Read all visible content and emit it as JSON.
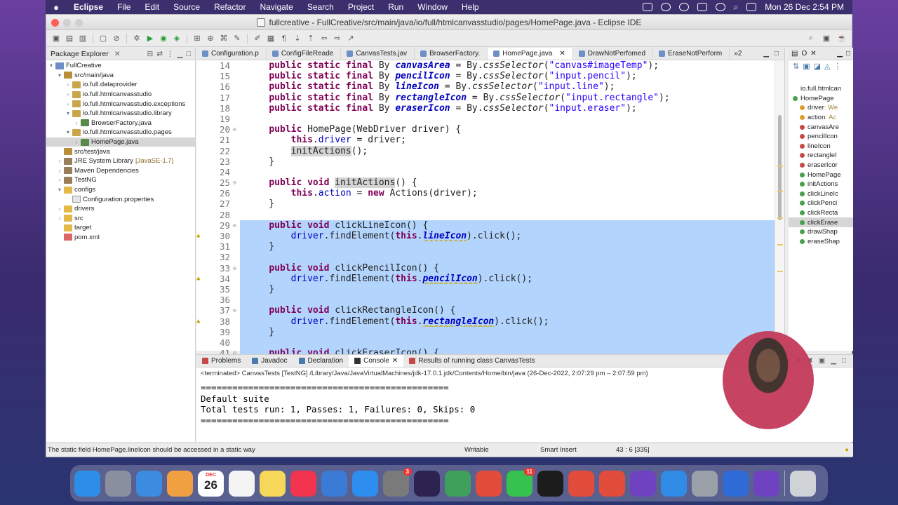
{
  "menubar": {
    "app": "Eclipse",
    "items": [
      "File",
      "Edit",
      "Source",
      "Refactor",
      "Navigate",
      "Search",
      "Project",
      "Run",
      "Window",
      "Help"
    ],
    "clock": "Mon 26 Dec  2:54 PM"
  },
  "window": {
    "title": "fullcreative - FullCreative/src/main/java/io/full/htmlcanvasstudio/pages/HomePage.java - Eclipse IDE"
  },
  "package_explorer": {
    "tab": "Package Explorer",
    "items": [
      {
        "label": "FullCreative",
        "indent": 0,
        "arrow": "▾",
        "icon": "proj"
      },
      {
        "label": "src/main/java",
        "indent": 1,
        "arrow": "▾",
        "icon": "src"
      },
      {
        "label": "io.full.dataprovider",
        "indent": 2,
        "arrow": "›",
        "icon": "pkg"
      },
      {
        "label": "io.full.htmlcanvasstudio",
        "indent": 2,
        "arrow": "›",
        "icon": "pkg"
      },
      {
        "label": "io.full.htmlcanvasstudio.exceptions",
        "indent": 2,
        "arrow": "›",
        "icon": "pkg"
      },
      {
        "label": "io.full.htmlcanvasstudio.library",
        "indent": 2,
        "arrow": "▾",
        "icon": "pkg"
      },
      {
        "label": "BrowserFactory.java",
        "indent": 3,
        "arrow": "›",
        "icon": "java"
      },
      {
        "label": "io.full.htmlcanvasstudio.pages",
        "indent": 2,
        "arrow": "▾",
        "icon": "pkg"
      },
      {
        "label": "HomePage.java",
        "indent": 3,
        "arrow": "›",
        "icon": "java",
        "selected": true
      },
      {
        "label": "src/test/java",
        "indent": 1,
        "arrow": "",
        "icon": "src"
      },
      {
        "label": "JRE System Library",
        "suffix": "[JavaSE-1.7]",
        "indent": 1,
        "arrow": "›",
        "icon": "lib"
      },
      {
        "label": "Maven Dependencies",
        "indent": 1,
        "arrow": "›",
        "icon": "lib"
      },
      {
        "label": "TestNG",
        "indent": 1,
        "arrow": "›",
        "icon": "lib"
      },
      {
        "label": "configs",
        "indent": 1,
        "arrow": "▾",
        "icon": "folder"
      },
      {
        "label": "Configuration.properties",
        "indent": 2,
        "arrow": "",
        "icon": "file"
      },
      {
        "label": "drivers",
        "indent": 1,
        "arrow": "›",
        "icon": "folder"
      },
      {
        "label": "src",
        "indent": 1,
        "arrow": "›",
        "icon": "folder"
      },
      {
        "label": "target",
        "indent": 1,
        "arrow": "",
        "icon": "folder"
      },
      {
        "label": "pom.xml",
        "indent": 1,
        "arrow": "",
        "icon": "xml"
      }
    ]
  },
  "editor": {
    "tabs": [
      {
        "label": "Configuration.p",
        "active": false
      },
      {
        "label": "ConfigFileReade",
        "active": false
      },
      {
        "label": "CanvasTests.jav",
        "active": false
      },
      {
        "label": "BrowserFactory.",
        "active": false
      },
      {
        "label": "HomePage.java",
        "active": true
      },
      {
        "label": "DrawNotPerfomed",
        "active": false
      },
      {
        "label": "EraseNotPerform",
        "active": false
      }
    ],
    "overflow": "»2",
    "lines": [
      {
        "n": "14",
        "html": "    <span class='kw'>public static final</span> By <span class='fld'>canvasArea</span> = By.<i>cssSelector</i>(<span class='str'>\"canvas#imageTemp\"</span>);"
      },
      {
        "n": "15",
        "html": "    <span class='kw'>public static final</span> By <span class='fld'>pencilIcon</span> = By.<i>cssSelector</i>(<span class='str'>\"input.pencil\"</span>);"
      },
      {
        "n": "16",
        "html": "    <span class='kw'>public static final</span> By <span class='fld'>lineIcon</span> = By.<i>cssSelector</i>(<span class='str'>\"input.line\"</span>);"
      },
      {
        "n": "17",
        "html": "    <span class='kw'>public static final</span> By <span class='fld'>rectangleIcon</span> = By.<i>cssSelector</i>(<span class='str'>\"input.rectangle\"</span>);"
      },
      {
        "n": "18",
        "html": "    <span class='kw'>public static final</span> By <span class='fld'>eraserIcon</span> = By.<i>cssSelector</i>(<span class='str'>\"input.eraser\"</span>);"
      },
      {
        "n": "19",
        "html": ""
      },
      {
        "n": "20",
        "fold": true,
        "html": "    <span class='kw'>public</span> HomePage(WebDriver driver) {"
      },
      {
        "n": "21",
        "html": "        <span class='kw'>this</span>.<span style='color:#0000c0'>driver</span> = driver;"
      },
      {
        "n": "22",
        "html": "        <span class='occur'>initActions</span>();"
      },
      {
        "n": "23",
        "html": "    }"
      },
      {
        "n": "24",
        "html": ""
      },
      {
        "n": "25",
        "fold": true,
        "html": "    <span class='kw'>public void</span> <span class='occur'>initActions</span>() {"
      },
      {
        "n": "26",
        "html": "        <span class='kw'>this</span>.<span style='color:#0000c0'>action</span> = <span class='kw'>new</span> Actions(driver);"
      },
      {
        "n": "27",
        "html": "    }"
      },
      {
        "n": "28",
        "html": ""
      },
      {
        "n": "29",
        "fold": true,
        "hl": true,
        "html": "    <span class='kw'>public void</span> clickLineIcon() {"
      },
      {
        "n": "30",
        "hl": true,
        "warn": true,
        "html": "        <span style='color:#0000c0'>driver</span>.findElement(<span class='kw'>this</span>.<span class='fld wavy'>lineIcon</span>).click();"
      },
      {
        "n": "31",
        "hl": true,
        "html": "    }"
      },
      {
        "n": "32",
        "hl": true,
        "html": ""
      },
      {
        "n": "33",
        "fold": true,
        "hl": true,
        "html": "    <span class='kw'>public void</span> clickPencilIcon() {"
      },
      {
        "n": "34",
        "hl": true,
        "warn": true,
        "html": "        <span style='color:#0000c0'>driver</span>.findElement(<span class='kw'>this</span>.<span class='fld wavy'>pencilIcon</span>).click();"
      },
      {
        "n": "35",
        "hl": true,
        "html": "    }"
      },
      {
        "n": "36",
        "hl": true,
        "html": ""
      },
      {
        "n": "37",
        "fold": true,
        "hl": true,
        "html": "    <span class='kw'>public void</span> clickRectangleIcon() {"
      },
      {
        "n": "38",
        "hl": true,
        "warn": true,
        "html": "        <span style='color:#0000c0'>driver</span>.findElement(<span class='kw'>this</span>.<span class='fld wavy'>rectangleIcon</span>).click();"
      },
      {
        "n": "39",
        "hl": true,
        "html": "    }"
      },
      {
        "n": "40",
        "hl": true,
        "html": ""
      },
      {
        "n": "41",
        "fold": true,
        "hl": true,
        "html": "    <span class='kw'>public void</span> clickEraserIcon() {"
      }
    ]
  },
  "outline": {
    "items": [
      {
        "label": "io.full.htmlcan",
        "dot": "",
        "indent": 0
      },
      {
        "label": "HomePage",
        "dot": "g",
        "indent": 0
      },
      {
        "label": "driver",
        "suffix": " : We",
        "dot": "y",
        "indent": 1
      },
      {
        "label": "action",
        "suffix": " : Ac",
        "dot": "y",
        "indent": 1
      },
      {
        "label": "canvasAre",
        "dot": "r",
        "indent": 1
      },
      {
        "label": "pencilIcon",
        "dot": "r",
        "indent": 1
      },
      {
        "label": "lineIcon",
        "dot": "r",
        "indent": 1
      },
      {
        "label": "rectangleI",
        "dot": "r",
        "indent": 1
      },
      {
        "label": "eraserIcor",
        "dot": "r",
        "indent": 1
      },
      {
        "label": "HomePage",
        "dot": "g",
        "indent": 1
      },
      {
        "label": "initActions",
        "dot": "g",
        "indent": 1
      },
      {
        "label": "clickLineIc",
        "dot": "g",
        "indent": 1
      },
      {
        "label": "clickPenci",
        "dot": "g",
        "indent": 1
      },
      {
        "label": "clickRecta",
        "dot": "g",
        "indent": 1
      },
      {
        "label": "clickErase",
        "dot": "g",
        "indent": 1,
        "selected": true
      },
      {
        "label": "drawShap",
        "dot": "g",
        "indent": 1
      },
      {
        "label": "eraseShap",
        "dot": "g",
        "indent": 1
      }
    ]
  },
  "console": {
    "tabs": [
      "Problems",
      "Javadoc",
      "Declaration",
      "Console",
      "Results of running class CanvasTests"
    ],
    "terminated": "<terminated> CanvasTests [TestNG] /Library/Java/JavaVirtualMachines/jdk-17.0.1.jdk/Contents/Home/bin/java  (26-Dec-2022, 2:07:29 pm – 2:07:59 pm)",
    "output": [
      "===============================================",
      "Default suite",
      "Total tests run: 1, Passes: 1, Failures: 0, Skips: 0",
      "==============================================="
    ]
  },
  "status": {
    "message": "The static field HomePage.lineIcon should be accessed in a static way",
    "writable": "Writable",
    "insert_mode": "Smart Insert",
    "position": "43 : 6 [335]"
  },
  "dock": {
    "apps": [
      {
        "name": "finder",
        "color": "#2d8ee8"
      },
      {
        "name": "launchpad",
        "color": "#8a8fa0"
      },
      {
        "name": "mail",
        "color": "#3b8be0"
      },
      {
        "name": "photos",
        "color": "#f0a040"
      },
      {
        "name": "calendar",
        "color": "#ffffff",
        "month": "DEC",
        "day": "26"
      },
      {
        "name": "reminders",
        "color": "#f4f4f4"
      },
      {
        "name": "notes",
        "color": "#f7d75a"
      },
      {
        "name": "music",
        "color": "#f3344e"
      },
      {
        "name": "keynote",
        "color": "#3a7bd5"
      },
      {
        "name": "app-store",
        "color": "#2e8ef0"
      },
      {
        "name": "system-preferences",
        "color": "#7a7a7a",
        "badge": "3"
      },
      {
        "name": "eclipse",
        "color": "#2c2350"
      },
      {
        "name": "android-studio",
        "color": "#3ea05a"
      },
      {
        "name": "chrome",
        "color": "#e24c3a"
      },
      {
        "name": "whatsapp",
        "color": "#36c24f",
        "badge": "11"
      },
      {
        "name": "terminal",
        "color": "#1c1c1c"
      },
      {
        "name": "chrome-2",
        "color": "#e24c3a"
      },
      {
        "name": "chrome-3",
        "color": "#e24c3a"
      },
      {
        "name": "github-desktop",
        "color": "#6f42c1"
      },
      {
        "name": "safari",
        "color": "#2f8be6"
      },
      {
        "name": "quicktime",
        "color": "#9aa0a8"
      },
      {
        "name": "audio-app",
        "color": "#2f6bd6"
      },
      {
        "name": "github-desktop-2",
        "color": "#6f42c1"
      },
      {
        "name": "trash",
        "color": "#cfd3d8"
      }
    ]
  }
}
